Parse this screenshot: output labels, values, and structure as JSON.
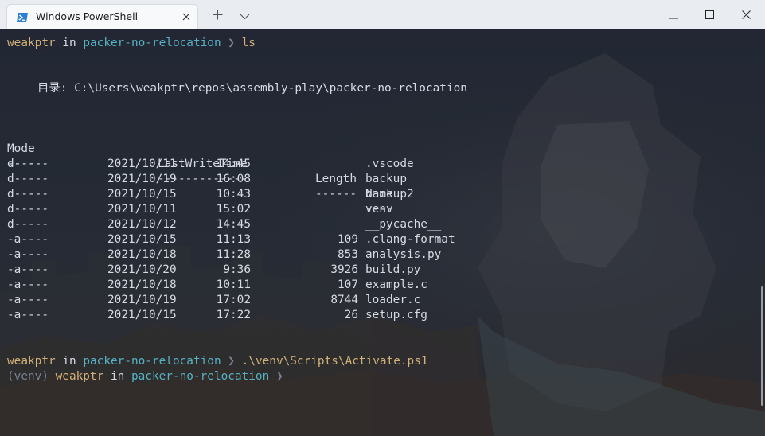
{
  "window": {
    "tab_title": "Windows PowerShell",
    "new_tab_symbol": "+",
    "icons": [
      "powershell-icon",
      "close-icon",
      "plus-icon",
      "chevron-down-icon",
      "minimize-icon",
      "maximize-icon",
      "window-close-icon"
    ]
  },
  "prompt1": {
    "user": "weakptr",
    "in": "in",
    "dir": "packer-no-relocation",
    "arrow": "❯",
    "command": "ls"
  },
  "directory_line": {
    "label": "目录: ",
    "path": "C:\\Users\\weakptr\\repos\\assembly-play\\packer-no-relocation"
  },
  "listing": {
    "headers": {
      "mode": "Mode",
      "lastwritetime": "LastWriteTime",
      "length": "Length",
      "name": "Name"
    },
    "underlines": {
      "mode": "----",
      "lastwritetime": "-------------",
      "length": "------",
      "name": "----"
    },
    "rows": [
      {
        "mode": "d-----",
        "date": "2021/10/11",
        "time": "14:45",
        "length": "",
        "name": ".vscode"
      },
      {
        "mode": "d-----",
        "date": "2021/10/19",
        "time": "16:08",
        "length": "",
        "name": "backup"
      },
      {
        "mode": "d-----",
        "date": "2021/10/15",
        "time": "10:43",
        "length": "",
        "name": "backup2"
      },
      {
        "mode": "d-----",
        "date": "2021/10/11",
        "time": "15:02",
        "length": "",
        "name": "venv"
      },
      {
        "mode": "d-----",
        "date": "2021/10/12",
        "time": "14:45",
        "length": "",
        "name": "__pycache__"
      },
      {
        "mode": "-a----",
        "date": "2021/10/15",
        "time": "11:13",
        "length": "109",
        "name": ".clang-format"
      },
      {
        "mode": "-a----",
        "date": "2021/10/18",
        "time": "11:28",
        "length": "853",
        "name": "analysis.py"
      },
      {
        "mode": "-a----",
        "date": "2021/10/20",
        "time": "9:36",
        "length": "3926",
        "name": "build.py"
      },
      {
        "mode": "-a----",
        "date": "2021/10/18",
        "time": "10:11",
        "length": "107",
        "name": "example.c"
      },
      {
        "mode": "-a----",
        "date": "2021/10/19",
        "time": "17:02",
        "length": "8744",
        "name": "loader.c"
      },
      {
        "mode": "-a----",
        "date": "2021/10/15",
        "time": "17:22",
        "length": "26",
        "name": "setup.cfg"
      }
    ]
  },
  "prompt2": {
    "user": "weakptr",
    "in": "in",
    "dir": "packer-no-relocation",
    "arrow": "❯",
    "command": ".\\venv\\Scripts\\Activate.ps1"
  },
  "prompt3": {
    "venv": "(venv)",
    "user": "weakptr",
    "in": "in",
    "dir": "packer-no-relocation",
    "arrow": "❯"
  },
  "colors": {
    "user": "#d2b17a",
    "path": "#56b1c3",
    "text": "#d5dae3",
    "dim": "#7a8192",
    "background": "#232833"
  }
}
